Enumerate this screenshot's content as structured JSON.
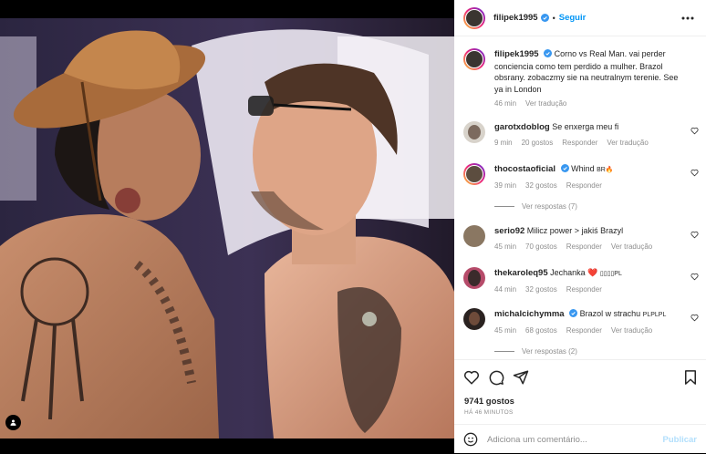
{
  "post": {
    "author": "filipek1995",
    "follow_label": "Seguir",
    "dot": "•"
  },
  "caption": {
    "username": "filipek1995",
    "text": "Corno vs Real Man. vai perder conciencia como tem perdido a mulher. Brazol obsrany. zobaczmy sie na neutralnym terenie. See ya in London",
    "time": "46 min",
    "translate_label": "Ver tradução"
  },
  "comments": [
    {
      "username": "garotxdoblog",
      "text": "Se enxerga meu fi",
      "time": "9 min",
      "likes": "20 gostos",
      "reply": "Responder",
      "translate": "Ver tradução"
    },
    {
      "username": "thocostaoficial",
      "text": "Whind",
      "suffix": "BR🔥",
      "time": "39 min",
      "likes": "32 gostos",
      "reply": "Responder",
      "view_replies": "Ver respostas (7)"
    },
    {
      "username": "serio92",
      "text": "Milicz power > jakiś Brazyl",
      "time": "45 min",
      "likes": "70 gostos",
      "reply": "Responder",
      "translate": "Ver tradução"
    },
    {
      "username": "thekaroleq95",
      "text": "Jechanka ❤️",
      "suffix": "▯▯▯▯PL",
      "time": "44 min",
      "likes": "32 gostos",
      "reply": "Responder"
    },
    {
      "username": "michalcichymma",
      "text": "Brazol w strachu",
      "suffix": "PLPLPL",
      "time": "45 min",
      "likes": "68 gostos",
      "reply": "Responder",
      "translate": "Ver tradução",
      "view_replies": "Ver respostas (2)"
    }
  ],
  "footer": {
    "likes": "9741 gostos",
    "time": "HÁ 46 MINUTOS",
    "comment_placeholder": "Adiciona um comentário...",
    "publish_label": "Publicar"
  },
  "icons": {
    "like": "heart-icon",
    "comment": "comment-icon",
    "share": "share-icon",
    "save": "bookmark-icon",
    "emoji": "emoji-icon",
    "more": "more-icon",
    "tag": "user-tag-icon"
  },
  "colors": {
    "accent": "#0095f6",
    "verified": "#3897f0",
    "muted": "#8e8e8e",
    "text": "#262626",
    "publish_disabled": "#b2dffc"
  }
}
